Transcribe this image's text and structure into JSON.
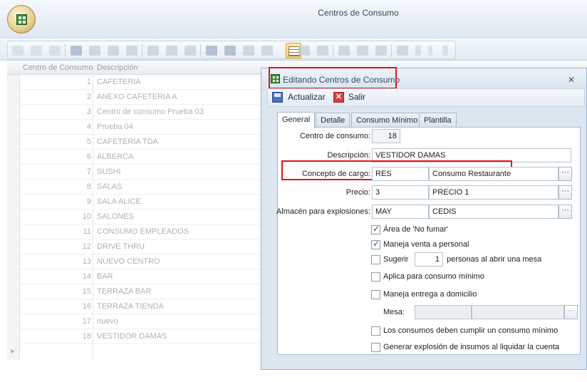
{
  "window": {
    "title": "Centros de Consumo"
  },
  "grid": {
    "columns": [
      "Centro de Consumo",
      "Descripción"
    ],
    "rows": [
      {
        "id": "1",
        "desc": "CAFETERIA"
      },
      {
        "id": "2",
        "desc": "ANEXO CAFETERIA A"
      },
      {
        "id": "3",
        "desc": "Centro de consumo Prueba 03"
      },
      {
        "id": "4",
        "desc": "Prueba 04"
      },
      {
        "id": "5",
        "desc": "CAFETERIA TDA"
      },
      {
        "id": "6",
        "desc": "ALBERCA"
      },
      {
        "id": "7",
        "desc": "SUSHI"
      },
      {
        "id": "8",
        "desc": "SALAS"
      },
      {
        "id": "9",
        "desc": "SALA ALICE"
      },
      {
        "id": "10",
        "desc": "SALONES"
      },
      {
        "id": "11",
        "desc": "CONSUMO EMPLEADOS"
      },
      {
        "id": "12",
        "desc": "DRIVE THRU"
      },
      {
        "id": "13",
        "desc": "NUEVO CENTRO"
      },
      {
        "id": "14",
        "desc": "BAR"
      },
      {
        "id": "15",
        "desc": "TERRAZA BAR"
      },
      {
        "id": "16",
        "desc": "TERRAZA TIENDA"
      },
      {
        "id": "17",
        "desc": "nuevo"
      },
      {
        "id": "18",
        "desc": "VESTIDOR DAMAS"
      }
    ]
  },
  "dialog": {
    "title": "Editando Centros de Consumo",
    "close": "✕",
    "toolbar": {
      "update": "Actualizar",
      "exit": "Salir"
    },
    "tabs": [
      "General",
      "Detalle",
      "Consumo Mínimo",
      "Plantilla"
    ],
    "form": {
      "centro_label": "Centro de consumo:",
      "centro_value": "18",
      "descripcion_label": "Descripción:",
      "descripcion_value": "VESTIDOR DAMAS",
      "concepto_label": "Concepto de cargo:",
      "concepto_code": "RES",
      "concepto_name": "Consumo Restaurante",
      "precio_label": "Precio:",
      "precio_code": "3",
      "precio_name": "PRECIO 1",
      "almacen_label": "Almacén para explosiones:",
      "almacen_code": "MAY",
      "almacen_name": "CEDIS",
      "ellipsis": "···",
      "chk_no_fumar": "Área de 'No fumar'",
      "chk_venta_personal": "Maneja venta a personal",
      "chk_sugerir": "Sugerir",
      "sugerir_value": "1",
      "sugerir_suffix": "personas al abrir una mesa",
      "chk_consumo_minimo": "Aplica para consumo mínimo",
      "chk_domicilio": "Maneja entrega a domicilio",
      "mesa_label": "Mesa:",
      "chk_cumplir": "Los consumos deben cumplir un consumo mínimo",
      "chk_explosion": "Generar explosión de insumos al liquidar la cuenta"
    },
    "checked": {
      "no_fumar": true,
      "venta_personal": true,
      "sugerir": false,
      "consumo_minimo": false,
      "domicilio": false,
      "cumplir": false,
      "explosion": false
    }
  },
  "colors": {
    "highlight": "#e0161b",
    "accent": "#fbd46a"
  }
}
